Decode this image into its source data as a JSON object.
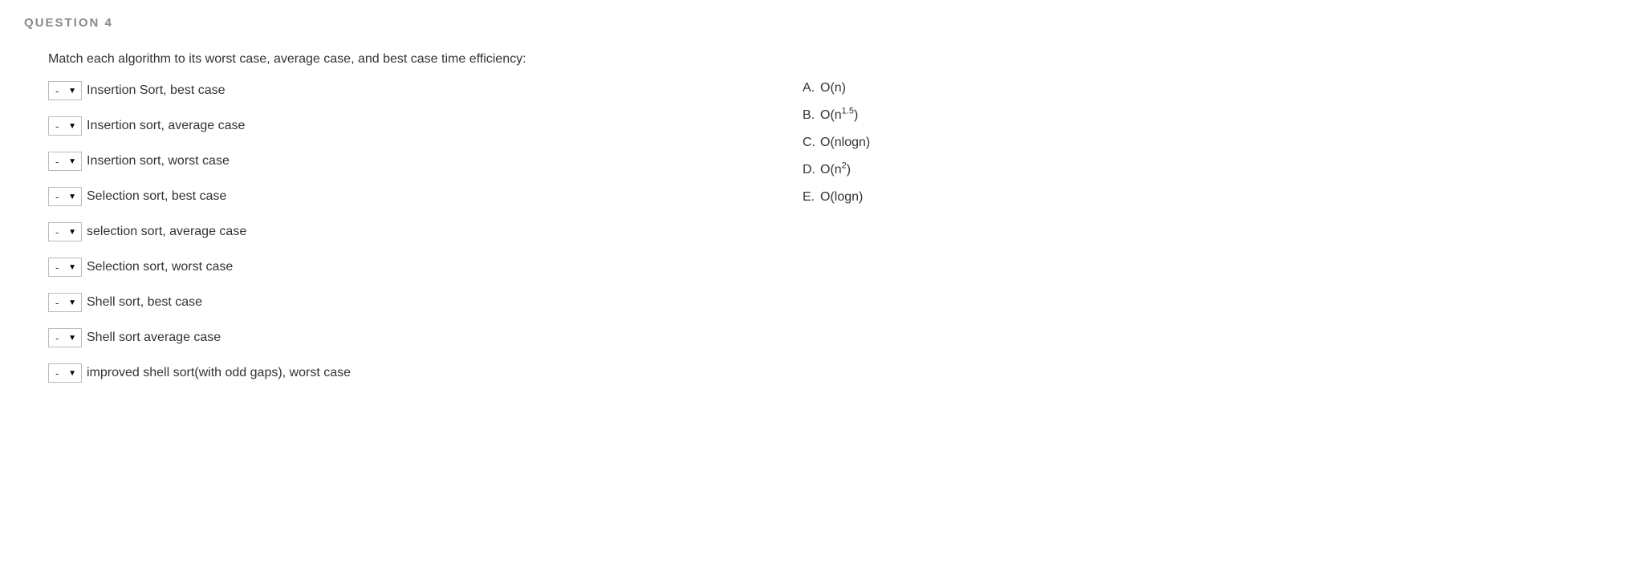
{
  "header": "QUESTION 4",
  "prompt": "Match each algorithm to its worst case, average case, and best case time efficiency:",
  "dropdown_value": "-",
  "items": [
    {
      "label": "Insertion Sort, best case"
    },
    {
      "label": "Insertion sort, average case"
    },
    {
      "label": "Insertion sort, worst case"
    },
    {
      "label": "Selection sort, best case"
    },
    {
      "label": "selection sort, average case"
    },
    {
      "label": "Selection sort, worst case"
    },
    {
      "label": "Shell sort, best case"
    },
    {
      "label": "Shell sort average case"
    },
    {
      "label": "improved shell sort(with odd gaps), worst case"
    }
  ],
  "answers": [
    {
      "letter": "A.",
      "base": "O(n)",
      "sup": ""
    },
    {
      "letter": "B.",
      "base": "O(n",
      "sup": "1.5",
      "tail": ")"
    },
    {
      "letter": "C.",
      "base": "O(nlogn)",
      "sup": ""
    },
    {
      "letter": "D.",
      "base": "O(n",
      "sup": "2",
      "tail": ")"
    },
    {
      "letter": "E.",
      "base": "O(logn)",
      "sup": ""
    }
  ]
}
